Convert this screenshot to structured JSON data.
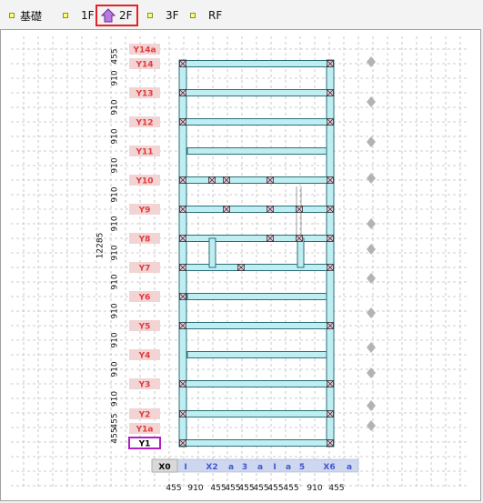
{
  "tabs": [
    {
      "label": "基礎",
      "active": false
    },
    {
      "label": "1F",
      "active": false
    },
    {
      "label": "2F",
      "active": true
    },
    {
      "label": "3F",
      "active": false
    },
    {
      "label": "RF",
      "active": false
    }
  ],
  "colors": {
    "beam_fill": "#bfeef2",
    "beam_stroke": "#2a6f78",
    "grid_line": "#bdbdbd",
    "y_label_bg": "#f2d4d4",
    "y_label_text": "#e23a3a",
    "x_label_bg": "#cdd8f0",
    "x_label_text": "#4455cc",
    "active_tab_border": "#e0242a",
    "selected_label_border": "#b31fc4"
  },
  "y_axis": {
    "labels": [
      "Y14a",
      "Y14",
      "Y13",
      "Y12",
      "Y11",
      "Y10",
      "Y9",
      "Y8",
      "Y7",
      "Y6",
      "Y5",
      "Y4",
      "Y3",
      "Y2",
      "Y1a",
      "Y1"
    ],
    "selected": "Y1",
    "dims": [
      "455",
      "910",
      "910",
      "910",
      "910",
      "910",
      "910",
      "910",
      "910",
      "910",
      "910",
      "910",
      "910",
      "455",
      "455"
    ],
    "total": "12285"
  },
  "x_axis": {
    "labels": [
      "X0",
      "I",
      "X2",
      "a",
      "3",
      "a",
      "I",
      "a",
      "5",
      "X6",
      "a"
    ],
    "dims": [
      "455",
      "910",
      "455",
      "455",
      "455",
      "455",
      "455",
      "455",
      "910",
      "455"
    ]
  }
}
